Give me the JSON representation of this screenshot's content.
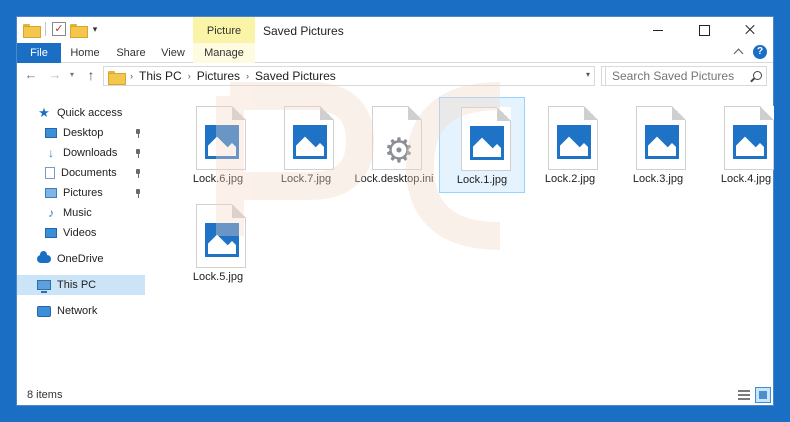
{
  "window": {
    "title": "Saved Pictures",
    "context_tab_group": "Picture Tools"
  },
  "ribbon": {
    "tabs": [
      "File",
      "Home",
      "Share",
      "View",
      "Manage"
    ]
  },
  "address": {
    "crumbs": [
      "This PC",
      "Pictures",
      "Saved Pictures"
    ]
  },
  "search": {
    "placeholder": "Search Saved Pictures"
  },
  "nav_pane": {
    "quick_access": "Quick access",
    "items": [
      "Desktop",
      "Downloads",
      "Documents",
      "Pictures",
      "Music",
      "Videos"
    ],
    "onedrive": "OneDrive",
    "this_pc": "This PC",
    "network": "Network"
  },
  "files": [
    {
      "name": "Lock.6.jpg",
      "type": "image"
    },
    {
      "name": "Lock.7.jpg",
      "type": "image"
    },
    {
      "name": "Lock.desktop.ini",
      "type": "settings"
    },
    {
      "name": "Lock.1.jpg",
      "type": "image"
    },
    {
      "name": "Lock.2.jpg",
      "type": "image"
    },
    {
      "name": "Lock.3.jpg",
      "type": "image"
    },
    {
      "name": "Lock.4.jpg",
      "type": "image"
    },
    {
      "name": "Lock.5.jpg",
      "type": "image"
    }
  ],
  "status": {
    "item_count": "8 items"
  },
  "colors": {
    "accent": "#1a6fc4",
    "context_tab": "#faf4a8",
    "selection": "#cce4f7"
  }
}
